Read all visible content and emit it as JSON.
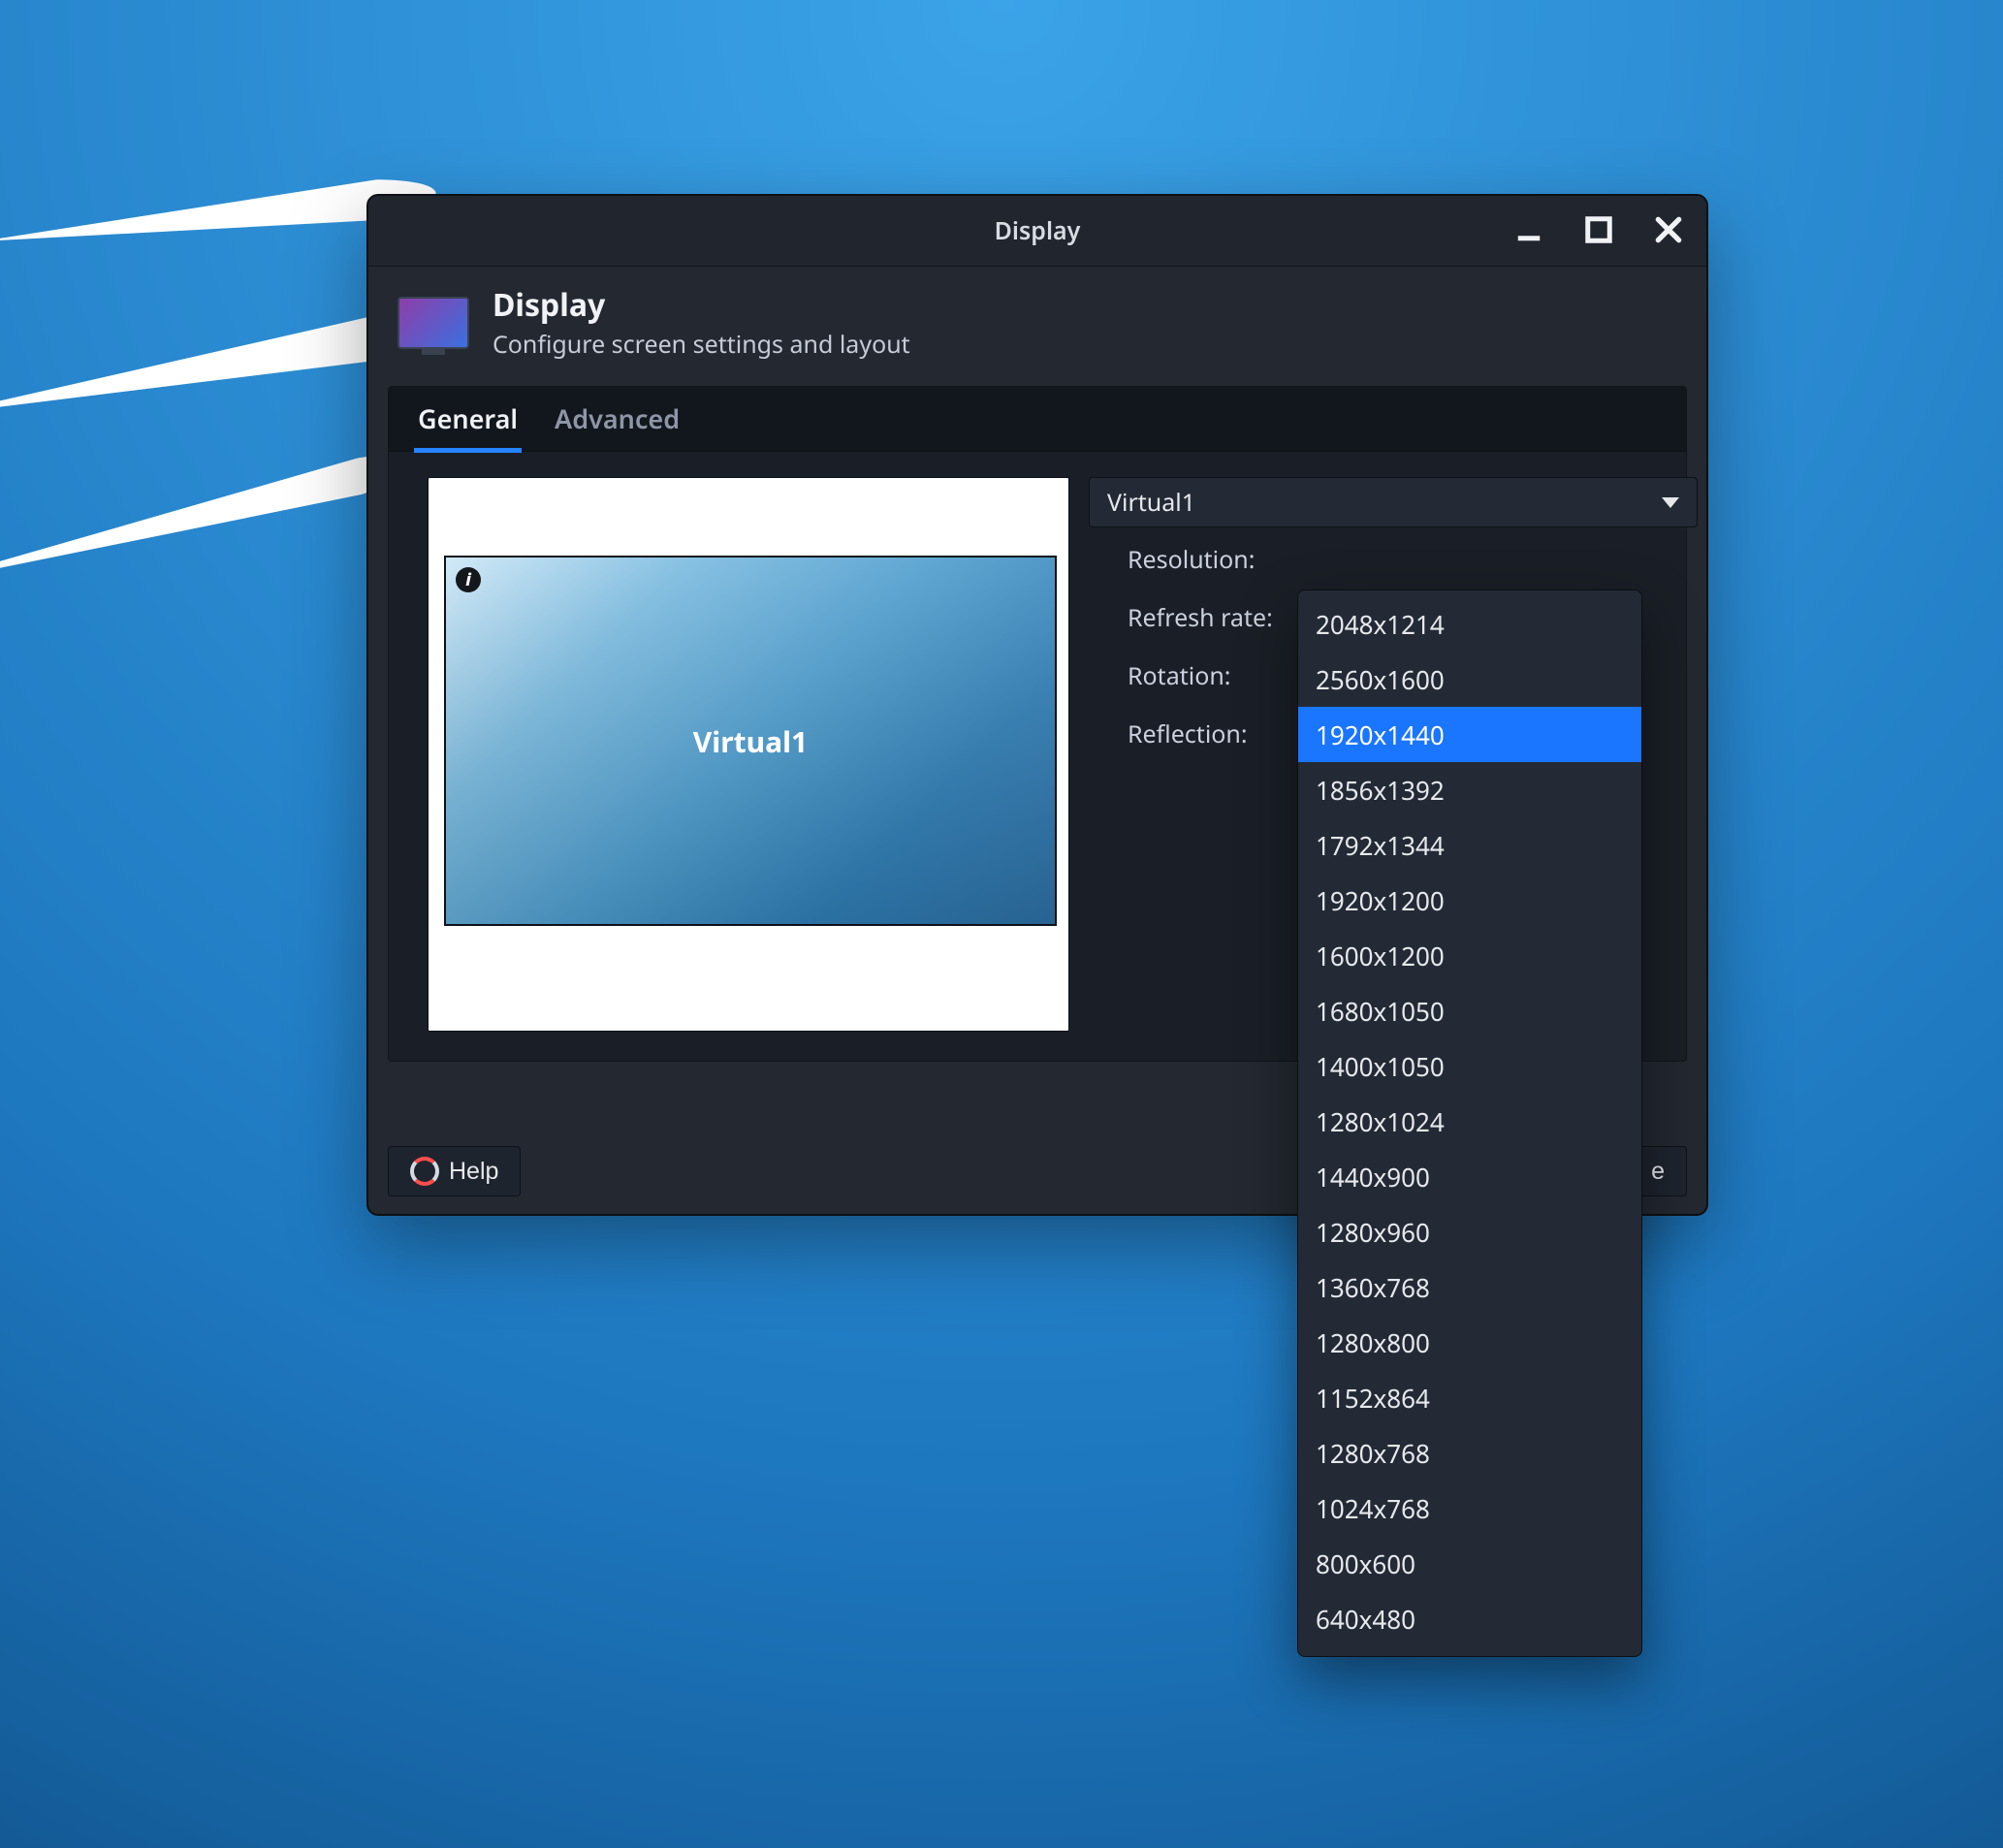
{
  "window": {
    "title": "Display"
  },
  "header": {
    "title": "Display",
    "subtitle": "Configure screen settings and layout"
  },
  "tabs": {
    "general": "General",
    "advanced": "Advanced"
  },
  "display_selector": {
    "value": "Virtual1"
  },
  "preview": {
    "display_name": "Virtual1"
  },
  "labels": {
    "resolution": "Resolution:",
    "refresh": "Refresh rate:",
    "rotation": "Rotation:",
    "reflection": "Reflection:"
  },
  "footer": {
    "help": "Help",
    "close_suffix": "e"
  },
  "resolution_options": [
    "2048x1214",
    "2560x1600",
    "1920x1440",
    "1856x1392",
    "1792x1344",
    "1920x1200",
    "1600x1200",
    "1680x1050",
    "1400x1050",
    "1280x1024",
    "1440x900",
    "1280x960",
    "1360x768",
    "1280x800",
    "1152x864",
    "1280x768",
    "1024x768",
    "800x600",
    "640x480"
  ],
  "resolution_selected_index": 2
}
